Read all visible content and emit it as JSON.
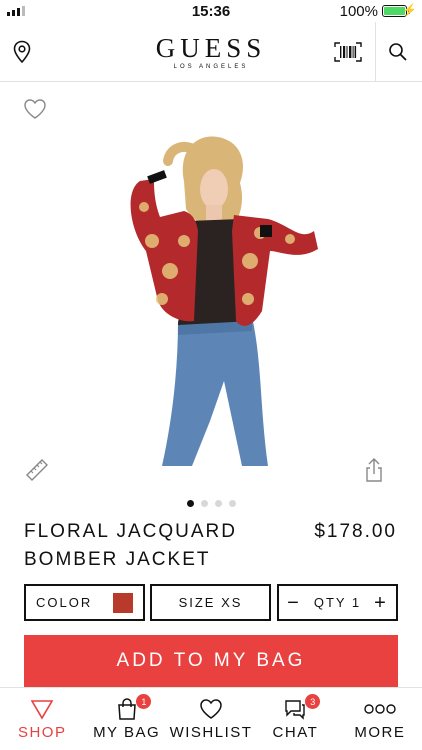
{
  "status": {
    "time": "15:36",
    "battery": "100%"
  },
  "header": {
    "brand": "GUESS",
    "brand_sub": "LOS ANGELES"
  },
  "product": {
    "title": "FLORAL JACQUARD\nBOMBER JACKET",
    "price": "$178.00",
    "image_count": 4,
    "active_image": 1
  },
  "options": {
    "color_label": "COLOR",
    "size_label": "SIZE XS",
    "qty_label": "QTY 1",
    "qty_minus": "−",
    "qty_plus": "+"
  },
  "actions": {
    "add_to_bag": "ADD TO MY BAG"
  },
  "tabs": [
    {
      "label": "SHOP",
      "icon": "shop-icon",
      "active": true
    },
    {
      "label": "MY BAG",
      "icon": "bag-icon",
      "badge": "1"
    },
    {
      "label": "WISHLIST",
      "icon": "heart-icon"
    },
    {
      "label": "CHAT",
      "icon": "chat-icon",
      "badge": "3"
    },
    {
      "label": "MORE",
      "icon": "more-icon"
    }
  ],
  "colors": {
    "accent": "#e8413f",
    "battery": "#4cd964"
  }
}
